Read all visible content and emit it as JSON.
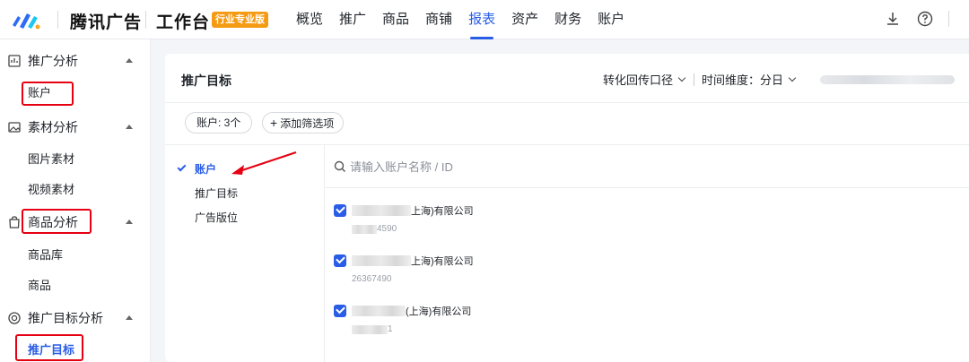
{
  "header": {
    "brand": "腾讯广告",
    "product": "工作台",
    "badge": "行业专业版",
    "nav": [
      "概览",
      "推广",
      "商品",
      "商铺",
      "报表",
      "资产",
      "财务",
      "账户"
    ],
    "active_nav": "报表",
    "icons": [
      "download-icon",
      "help-icon"
    ]
  },
  "sidebar": {
    "groups": [
      {
        "label": "推广分析",
        "icon": "report-icon",
        "items": [
          "账户"
        ]
      },
      {
        "label": "素材分析",
        "icon": "image-icon",
        "items": [
          "图片素材",
          "视频素材"
        ]
      },
      {
        "label": "商品分析",
        "icon": "bag-icon",
        "items": [
          "商品库",
          "商品"
        ]
      },
      {
        "label": "推广目标分析",
        "icon": "target-icon",
        "items": [
          "推广目标"
        ]
      }
    ],
    "active_item": "推广目标"
  },
  "main": {
    "title": "推广目标",
    "conversion": "转化回传口径",
    "time_dimension": "时间维度：分日",
    "filter_chip": "账户: 3个",
    "add_filter": "添加筛选项",
    "dimensions": [
      "账户",
      "推广目标",
      "广告版位"
    ],
    "active_dimension": "账户",
    "search_placeholder": "请输入账户名称 / ID",
    "accounts": [
      {
        "name_suffix": "上海)有限公司",
        "id_suffix": "4590",
        "checked": true
      },
      {
        "name_suffix": "上海)有限公司",
        "id": "26367490",
        "checked": true
      },
      {
        "name_suffix": "(上海)有限公司",
        "id_suffix": "1",
        "checked": true
      }
    ]
  },
  "colors": {
    "accent": "#2a5de6",
    "badge": "#f59a13",
    "highlight": "#e60012"
  }
}
